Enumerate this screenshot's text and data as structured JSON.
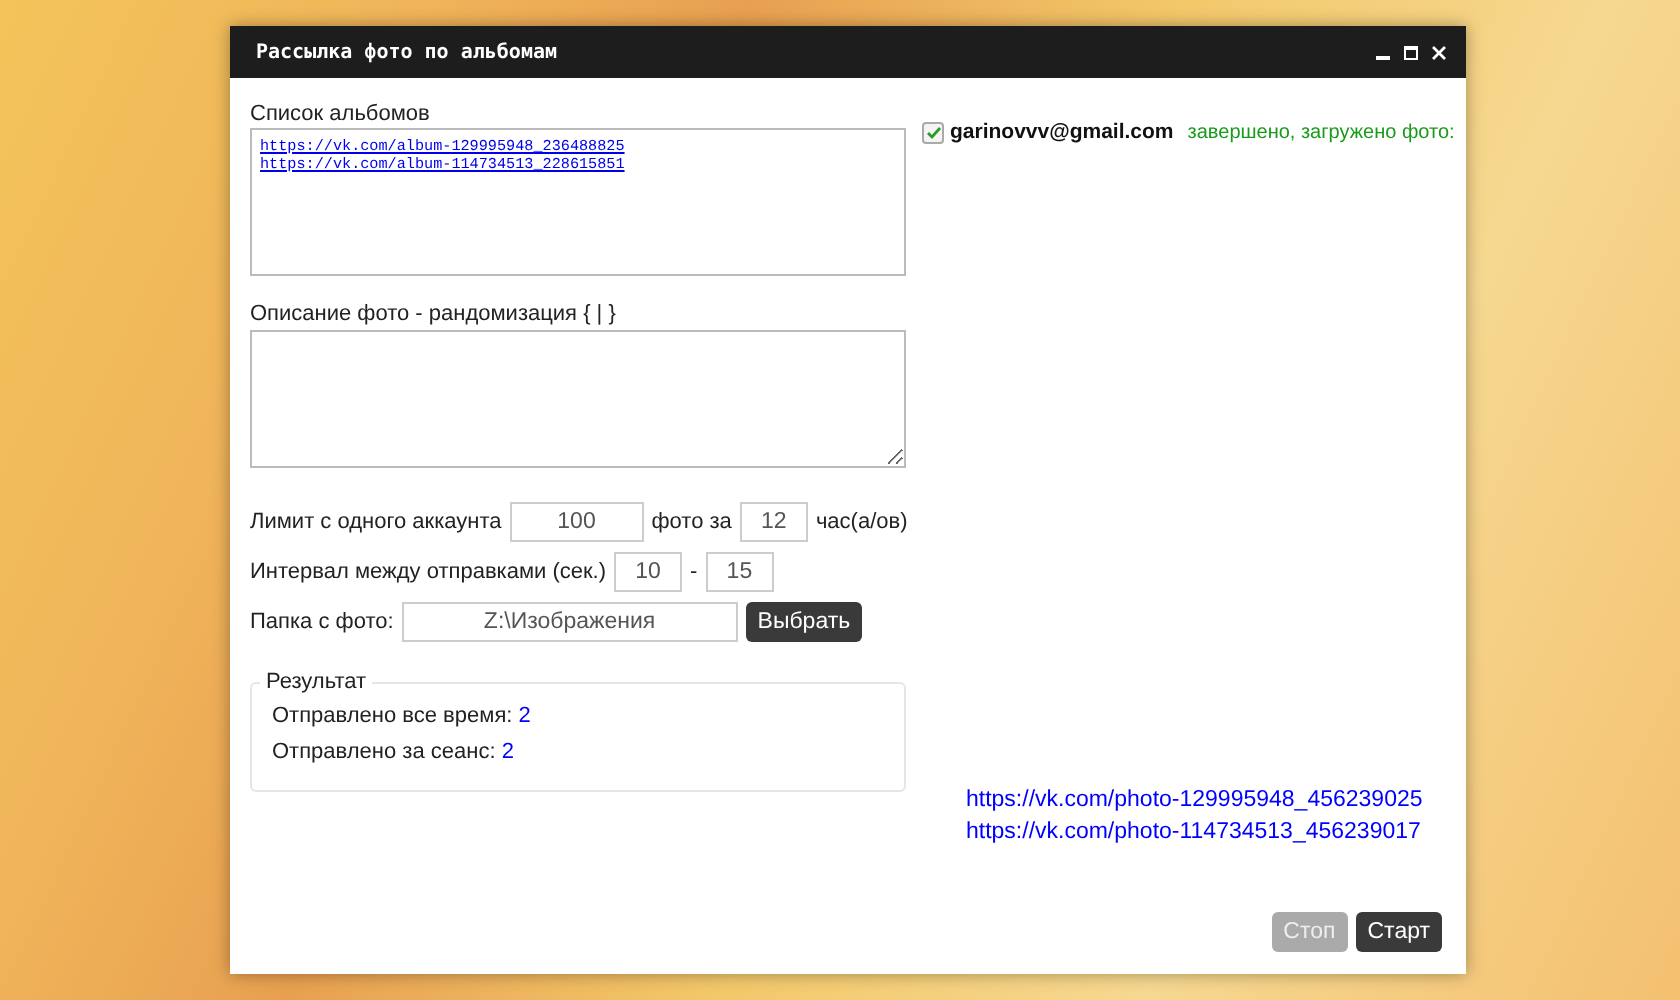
{
  "window": {
    "title": "Рассылка фото по альбомам"
  },
  "albums": {
    "label": "Список альбомов",
    "links": [
      "https://vk.com/album-129995948_236488825",
      "https://vk.com/album-114734513_228615851"
    ]
  },
  "description": {
    "label": "Описание фото - рандомизация { | }"
  },
  "limit": {
    "label": "Лимит с одного аккаунта",
    "count": "100",
    "middle": "фото за",
    "hours": "12",
    "unit": "час(а/ов)"
  },
  "interval": {
    "label": "Интервал между отправками (сек.)",
    "from": "10",
    "separator": "-",
    "to": "15"
  },
  "folder": {
    "label": "Папка с фото:",
    "value": "Z:\\Изображения",
    "button": "Выбрать"
  },
  "result": {
    "legend": "Результат",
    "rows": [
      {
        "label": "Отправлено все время:",
        "value": "2"
      },
      {
        "label": "Отправлено за сеанс:",
        "value": "2"
      }
    ]
  },
  "account": {
    "email": "garinovvv@gmail.com",
    "checked": true,
    "status": "завершено, загружено фото:"
  },
  "photo_links": [
    "https://vk.com/photo-129995948_456239025",
    "https://vk.com/photo-114734513_456239017"
  ],
  "buttons": [
    {
      "label": "Стоп",
      "disabled": true
    },
    {
      "label": "Старт",
      "disabled": false
    }
  ]
}
